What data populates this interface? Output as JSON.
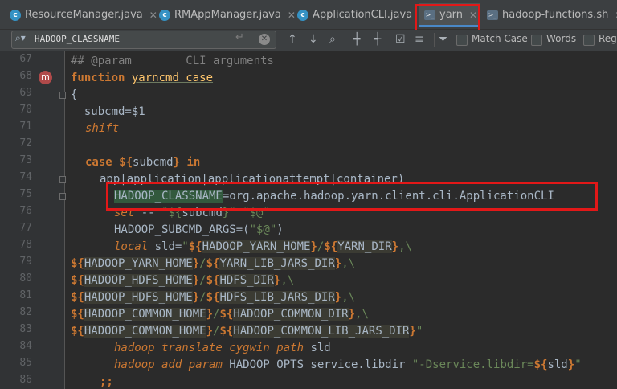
{
  "tabs": [
    {
      "label": "ResourceManager.java",
      "icon": "java-class-icon"
    },
    {
      "label": "RMAppManager.java",
      "icon": "java-class-icon"
    },
    {
      "label": "ApplicationCLI.java",
      "icon": "java-class-icon"
    },
    {
      "label": "yarn",
      "icon": "terminal-icon",
      "active": true
    },
    {
      "label": "hadoop-functions.sh",
      "icon": "terminal-icon"
    }
  ],
  "search": {
    "value": "HADOOP_CLASSNAME",
    "match_case_label": "Match Case",
    "words_label": "Words",
    "regex_label": "Rege"
  },
  "line_numbers": [
    "67",
    "68",
    "69",
    "70",
    "71",
    "72",
    "73",
    "74",
    "75",
    "76",
    "77",
    "78",
    "79",
    "80",
    "81",
    "82",
    "83",
    "84",
    "85",
    "86"
  ],
  "code": {
    "l67": {
      "c": "## @param        CLI arguments"
    },
    "l68": {
      "kw": "function",
      "name": "yarncmd_case"
    },
    "l69": {
      "t": "{"
    },
    "l70": {
      "t": "  subcmd=$1"
    },
    "l71": {
      "kw": "shift"
    },
    "l73": {
      "kw1": "case",
      "a": "${",
      "v": "subcmd",
      "b": "}",
      "kw2": "in"
    },
    "l74": {
      "t": "app|application|applicationattempt|container)"
    },
    "l75": {
      "match": "HADOOP_CLASSNAME",
      "rest": "=org.apache.hadoop.yarn.client.cli.ApplicationCLI"
    },
    "l76": {
      "kw": "set",
      "t1": " -- ",
      "s1": "\"${",
      "v": "subcmd",
      "s2": "}\"",
      "t2": " ",
      "s3": "\"$@\""
    },
    "l77": {
      "t": "HADOOP_SUBCMD_ARGS=(",
      "s": "\"$@\"",
      "t2": ")"
    },
    "l78": {
      "kw": "local",
      "t": " sld=",
      "q": "\"",
      "d1": "${",
      "v1": "HADOOP_YARN_HOME",
      "e1": "}",
      "sl": "/",
      "d2": "${",
      "v2": "YARN_DIR",
      "e2": "}",
      "tail": ",\\"
    },
    "l79": {
      "v1": "HADOOP_YARN_HOME",
      "v2": "YARN_LIB_JARS_DIR"
    },
    "l80": {
      "v1": "HADOOP_HDFS_HOME",
      "v2": "HDFS_DIR"
    },
    "l81": {
      "v1": "HADOOP_HDFS_HOME",
      "v2": "HDFS_LIB_JARS_DIR"
    },
    "l82": {
      "v1": "HADOOP_COMMON_HOME",
      "v2": "HADOOP_COMMON_DIR"
    },
    "l83": {
      "v1": "HADOOP_COMMON_HOME",
      "v2": "HADOOP_COMMON_LIB_JARS_DIR"
    },
    "l84": {
      "fn": "hadoop_translate_cygwin_path",
      "t": " sld"
    },
    "l85": {
      "fn": "hadoop_add_param",
      "t": " HADOOP_OPTS service.libdir ",
      "s": "\"-Dservice.libdir=",
      "d": "${",
      "v": "sld",
      "e": "}",
      "q": "\""
    },
    "l86": {
      "t": ";;"
    }
  },
  "colors": {
    "accent": "#4a88c7",
    "highlight_box": "#e21818",
    "keyword": "#cc7832",
    "function": "#ffc66d",
    "string": "#6a8759"
  }
}
